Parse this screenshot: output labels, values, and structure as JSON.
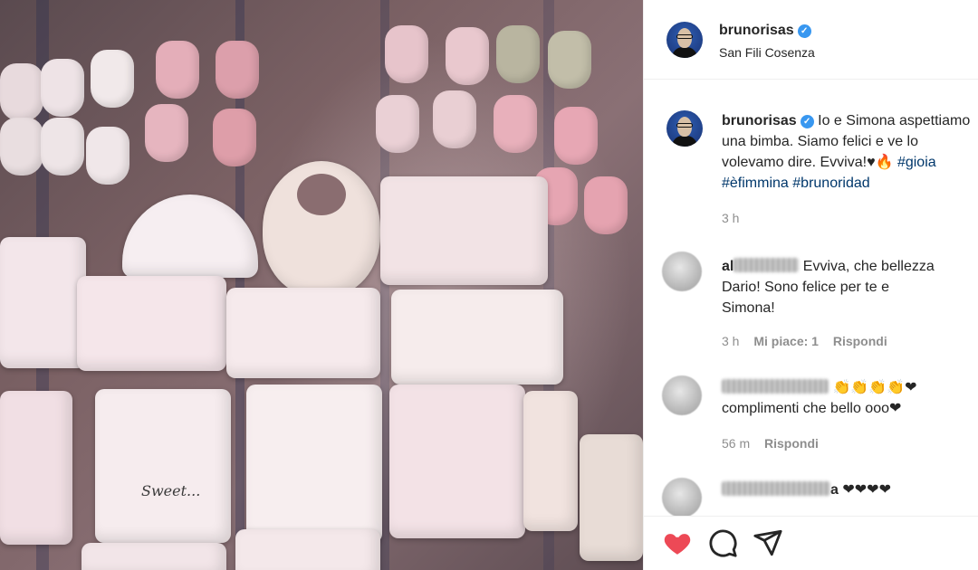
{
  "post": {
    "username": "brunorisas",
    "location": "San Fili Cosenza",
    "verified_mark": "✓"
  },
  "caption": {
    "username": "brunorisas",
    "line1": "Io e Simona aspettiamo",
    "line2": "una bimba. Siamo felici e ve lo",
    "line3": "volevamo dire. Evviva!",
    "emojis": "♥🔥",
    "hashtag1": "#gioia",
    "hashtag2": "#èfimmina",
    "hashtag3": "#brunoridad",
    "time": "3 h"
  },
  "comments": [
    {
      "username_visible": "al",
      "text_line1": "Evviva, che bellezza",
      "text_line2": "Dario! Sono felice per te e",
      "text_line3": "Simona!",
      "time": "3 h",
      "likes": "Mi piace: 1",
      "reply": "Rispondi"
    },
    {
      "emojis": "👏👏👏👏❤",
      "text_line2": "complimenti che bello ooo❤",
      "time": "56 m",
      "reply": "Rispondi"
    },
    {
      "username_tail": "a",
      "emojis": "❤❤❤❤"
    }
  ],
  "actions": {
    "like_icon": "heart-filled-icon",
    "comment_icon": "comment-icon",
    "share_icon": "share-icon",
    "like_color": "#ed4956"
  },
  "photo": {
    "embroidery_text": "Sweet..."
  }
}
